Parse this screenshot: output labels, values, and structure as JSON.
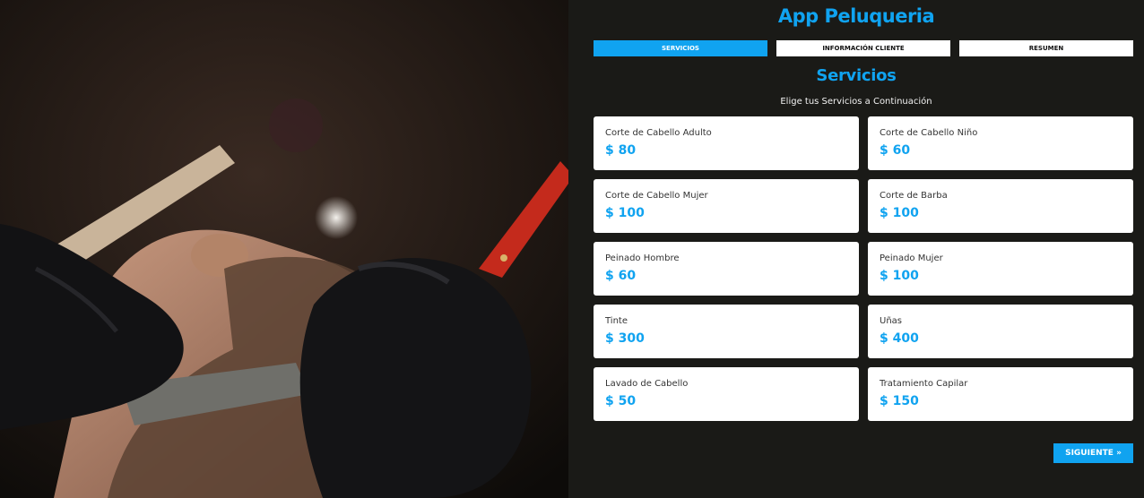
{
  "app": {
    "title": "App Peluqueria"
  },
  "tabs": [
    {
      "label": "SERVICIOS",
      "active": true
    },
    {
      "label": "INFORMACIÓN CLIENTE",
      "active": false
    },
    {
      "label": "RESUMEN",
      "active": false
    }
  ],
  "section": {
    "title": "Servicios",
    "subtitle": "Elige tus Servicios a Continuación"
  },
  "services": [
    {
      "name": "Corte de Cabello Adulto",
      "price": "$ 80"
    },
    {
      "name": "Corte de Cabello Niño",
      "price": "$ 60"
    },
    {
      "name": "Corte de Cabello Mujer",
      "price": "$ 100"
    },
    {
      "name": "Corte de Barba",
      "price": "$ 100"
    },
    {
      "name": "Peinado Hombre",
      "price": "$ 60"
    },
    {
      "name": "Peinado Mujer",
      "price": "$ 100"
    },
    {
      "name": "Tinte",
      "price": "$ 300"
    },
    {
      "name": "Uñas",
      "price": "$ 400"
    },
    {
      "name": "Lavado de Cabello",
      "price": "$ 50"
    },
    {
      "name": "Tratamiento Capilar",
      "price": "$ 150"
    }
  ],
  "actions": {
    "next_label": "SIGUIENTE »"
  },
  "colors": {
    "accent": "#10a3f0",
    "background": "#1a1a17",
    "card": "#ffffff"
  }
}
